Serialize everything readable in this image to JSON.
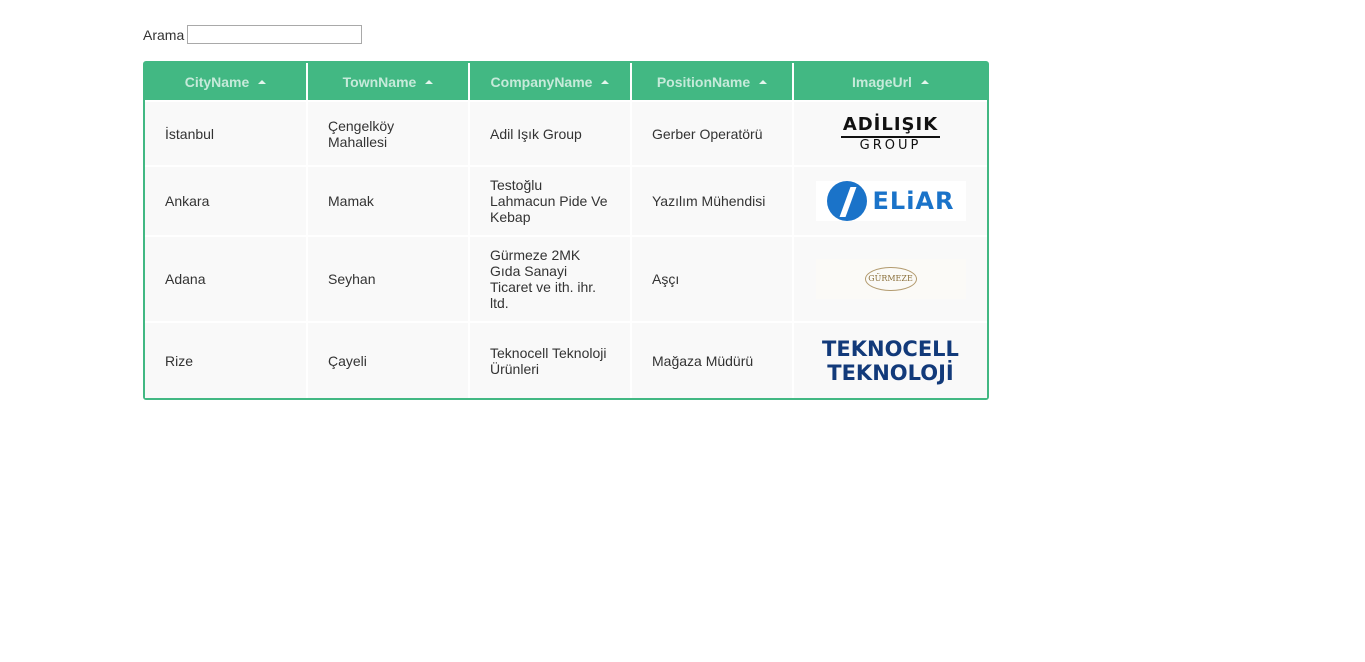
{
  "search": {
    "label": "Arama",
    "value": "",
    "placeholder": ""
  },
  "table": {
    "columns": [
      {
        "label": "CityName",
        "sort": "ascending"
      },
      {
        "label": "TownName",
        "sort": "ascending"
      },
      {
        "label": "CompanyName",
        "sort": "ascending"
      },
      {
        "label": "PositionName",
        "sort": "ascending"
      },
      {
        "label": "ImageUrl",
        "sort": "ascending"
      }
    ],
    "rows": [
      {
        "city": "İstanbul",
        "town": "Çengelköy Mahallesi",
        "company": "Adil Işık Group",
        "position": "Gerber Operatörü",
        "logo": {
          "name": "adilisik-logo",
          "line1": "ADİLIŞIK",
          "line2": "GROUP"
        }
      },
      {
        "city": "Ankara",
        "town": "Mamak",
        "company": "Testoğlu Lahmacun Pide Ve Kebap",
        "position": "Yazılım Mühendisi",
        "logo": {
          "name": "eliar-logo",
          "line1": "ELiAR"
        }
      },
      {
        "city": "Adana",
        "town": "Seyhan",
        "company": "Gürmeze 2MK Gıda Sanayi Ticaret ve ith. ihr. ltd.",
        "position": "Aşçı",
        "logo": {
          "name": "gurmeze-logo",
          "line1": "GÜRMEZE"
        }
      },
      {
        "city": "Rize",
        "town": "Çayeli",
        "company": "Teknocell Teknoloji Ürünleri",
        "position": "Mağaza Müdürü",
        "logo": {
          "name": "teknocell-logo",
          "line1": "TEKNOCELL",
          "line2": "TEKNOLOJİ"
        }
      }
    ]
  },
  "colors": {
    "accent": "#42b883",
    "row_background": "#f9f9f9",
    "eliar_blue": "#1a73c9",
    "teknocell_navy": "#123a7a"
  }
}
